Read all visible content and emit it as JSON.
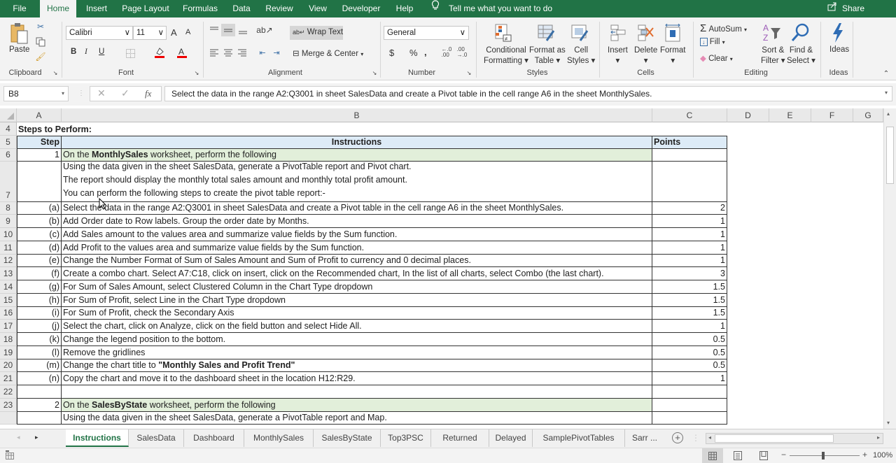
{
  "menu": {
    "tabs": [
      "File",
      "Home",
      "Insert",
      "Page Layout",
      "Formulas",
      "Data",
      "Review",
      "View",
      "Developer",
      "Help"
    ],
    "active_tab": "Home",
    "tell_me": "Tell me what you want to do",
    "share": "Share"
  },
  "ribbon": {
    "clipboard": {
      "paste": "Paste",
      "label": "Clipboard"
    },
    "font": {
      "name": "Calibri",
      "size": "11",
      "bold": "B",
      "italic": "I",
      "underline": "U",
      "grow": "A",
      "shrink": "A",
      "font_color": "A",
      "label": "Font"
    },
    "alignment": {
      "wrap_text": "Wrap Text",
      "merge_center": "Merge & Center",
      "label": "Alignment"
    },
    "number": {
      "format": "General",
      "currency": "$",
      "percent": "%",
      "comma": ",",
      "inc_decimal": ".0→.00",
      "dec_decimal": ".00→.0",
      "label": "Number"
    },
    "styles": {
      "conditional_formatting_1": "Conditional",
      "conditional_formatting_2": "Formatting",
      "format_as_table_1": "Format as",
      "format_as_table_2": "Table",
      "cell_styles_1": "Cell",
      "cell_styles_2": "Styles",
      "label": "Styles"
    },
    "cells": {
      "insert": "Insert",
      "delete": "Delete",
      "format": "Format",
      "label": "Cells"
    },
    "editing": {
      "autosum": "AutoSum",
      "fill": "Fill",
      "clear": "Clear",
      "sort_filter_1": "Sort &",
      "sort_filter_2": "Filter",
      "find_select_1": "Find &",
      "find_select_2": "Select",
      "label": "Editing"
    },
    "ideas": {
      "ideas": "Ideas",
      "label": "Ideas"
    }
  },
  "formula_bar": {
    "name_box": "B8",
    "fx": "fx",
    "formula": "Select the data in the range A2:Q3001 in sheet SalesData and create a Pivot table in the cell range A6 in the sheet MonthlySales."
  },
  "columns": [
    "A",
    "B",
    "C",
    "D",
    "E",
    "F",
    "G"
  ],
  "sheet": {
    "title": "Steps to Perform:",
    "header": {
      "step": "Step",
      "instructions": "Instructions",
      "points": "Points"
    },
    "rows": [
      {
        "row": "6",
        "step": "1",
        "pre": "On the ",
        "bold": "MonthlySales",
        "post": " worksheet, perform the following",
        "points": ""
      },
      {
        "row": "7",
        "step": "",
        "lines": [
          "Using the data given in the sheet SalesData, generate a PivotTable report and Pivot chart.",
          "The report should display the monthly total sales amount and monthly total profit amount.",
          "You can perform the following steps to create the pivot table report:-"
        ],
        "points": ""
      },
      {
        "row": "8",
        "step": "(a)",
        "text": "Select the data in the range A2:Q3001 in sheet SalesData and create a Pivot table in the cell range A6 in the sheet MonthlySales.",
        "points": "2"
      },
      {
        "row": "9",
        "step": "(b)",
        "text": "Add Order date to Row labels. Group the order date by Months.",
        "points": "1"
      },
      {
        "row": "10",
        "step": "(c)",
        "text": "Add Sales amount to the values area and summarize value fields by the Sum function.",
        "points": "1"
      },
      {
        "row": "11",
        "step": "(d)",
        "text": "Add Profit to the values area and summarize value fields by the Sum function.",
        "points": "1"
      },
      {
        "row": "12",
        "step": "(e)",
        "text": "Change the Number Format of Sum of Sales Amount and Sum of Profit to currency and 0 decimal places.",
        "points": "1"
      },
      {
        "row": "13",
        "step": "(f)",
        "text": "Create a combo chart. Select A7:C18, click on insert, click on the Recommended chart, In the list of all charts, select Combo (the last chart).",
        "points": "3"
      },
      {
        "row": "14",
        "step": "(g)",
        "text": "For Sum of Sales Amount, select Clustered Column in the Chart Type dropdown",
        "points": "1.5"
      },
      {
        "row": "15",
        "step": "(h)",
        "text": "For Sum of Profit, select Line in the Chart Type dropdown",
        "points": "1.5"
      },
      {
        "row": "16",
        "step": "(i)",
        "text": "For Sum of Profit, check the Secondary Axis",
        "points": "1.5"
      },
      {
        "row": "17",
        "step": "(j)",
        "text": "Select the chart, click on Analyze, click on the field button and select Hide All.",
        "points": "1"
      },
      {
        "row": "18",
        "step": "(k)",
        "text": "Change the legend position to the bottom.",
        "points": "0.5"
      },
      {
        "row": "19",
        "step": "(l)",
        "text": "Remove the gridlines",
        "points": "0.5"
      },
      {
        "row": "20",
        "step": "(m)",
        "pre": "Change the chart title to ",
        "bold": "\"Monthly Sales and Profit Trend\"",
        "post": "",
        "points": "0.5"
      },
      {
        "row": "21",
        "step": "(n)",
        "text": "Copy the chart and move it to the dashboard sheet in the location H12:R29.",
        "points": "1"
      },
      {
        "row": "22",
        "step": "",
        "text": "",
        "points": ""
      },
      {
        "row": "23",
        "step": "2",
        "pre": "On the ",
        "bold": "SalesByState",
        "post": " worksheet, perform the following",
        "points": ""
      },
      {
        "row": "24",
        "step": "",
        "text": "Using the data given in the sheet SalesData, generate a PivotTable report and Map.",
        "points": ""
      }
    ]
  },
  "sheet_tabs": [
    "Instructions",
    "SalesData",
    "Dashboard",
    "MonthlySales",
    "SalesByState",
    "Top3PSC",
    "Returned",
    "Delayed",
    "SamplePivotTables",
    "Sarr ..."
  ],
  "active_sheet": "Instructions",
  "status": {
    "zoom": "100%"
  }
}
